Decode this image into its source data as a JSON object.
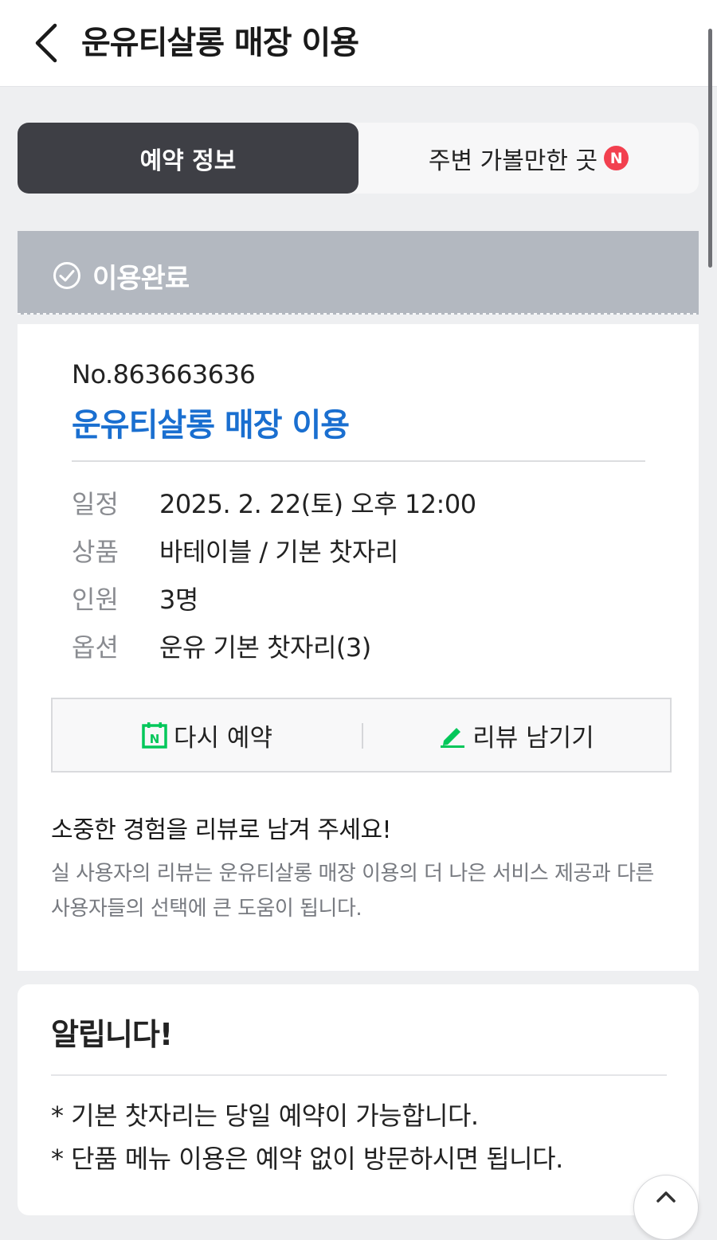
{
  "header": {
    "title": "운유티살롱 매장 이용"
  },
  "tabs": [
    {
      "label": "예약 정보",
      "active": true
    },
    {
      "label": "주변 가볼만한 곳",
      "badge": "N",
      "active": false
    }
  ],
  "status": {
    "label": "이용완료"
  },
  "reservation": {
    "number": "No.863663636",
    "title": "운유티살롱 매장 이용",
    "details": [
      {
        "label": "일정",
        "value": "2025. 2. 22(토) 오후 12:00"
      },
      {
        "label": "상품",
        "value": "바테이블 / 기본 찻자리"
      },
      {
        "label": "인원",
        "value": "3명"
      },
      {
        "label": "옵션",
        "value": "운유 기본 찻자리(3)"
      }
    ],
    "actions": {
      "rebook_label": "다시 예약",
      "rebook_icon_letter": "N",
      "review_label": "리뷰 남기기"
    },
    "review_prompt": {
      "heading": "소중한 경험을 리뷰로 남겨 주세요!",
      "description": "실 사용자의 리뷰는 운유티살롱 매장 이용의 더 나은 서비스 제공과 다른 사용자들의 선택에 큰 도움이 됩니다."
    }
  },
  "notice": {
    "title": "알립니다!",
    "lines": [
      "* 기본 찻자리는 당일 예약이 가능합니다.",
      "* 단품 메뉴 이용은 예약 없이 방문하시면 됩니다."
    ]
  },
  "colors": {
    "accent_blue": "#1a6fd0",
    "tab_active_bg": "#3e3f45",
    "status_bg": "#b3b8c0",
    "badge_red": "#f2404f",
    "naver_green": "#03c75a"
  }
}
